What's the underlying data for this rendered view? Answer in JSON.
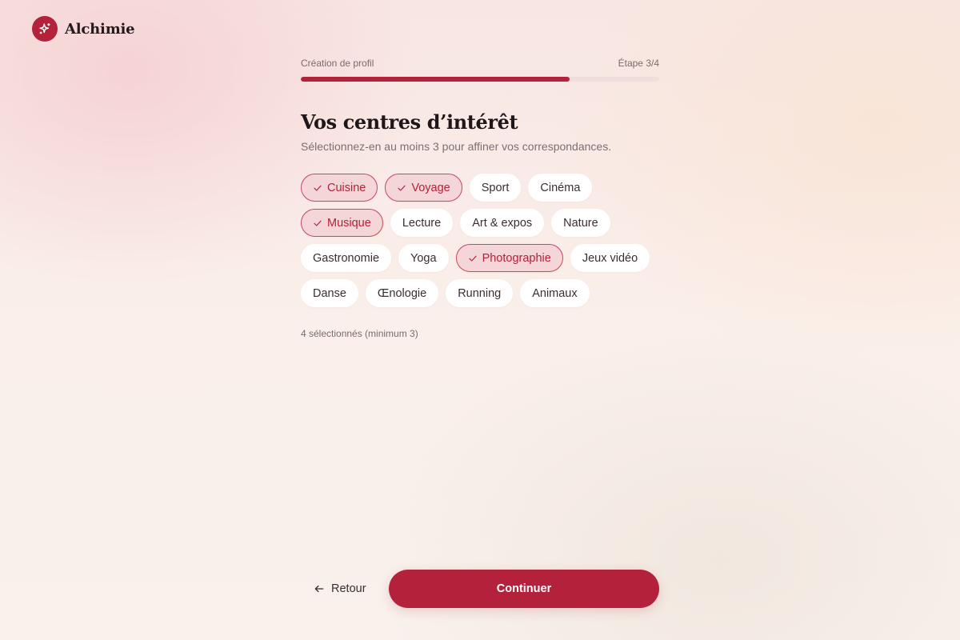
{
  "brand": {
    "name": "Alchimie",
    "logo_icon": "sparkle-icon"
  },
  "progress": {
    "label": "Création de profil",
    "step": "Étape 3/4",
    "fraction": 0.75
  },
  "heading": {
    "title": "Vos centres d’intérêt",
    "subtitle": "Sélectionnez-en au moins 3 pour affiner vos correspondances."
  },
  "interests": [
    {
      "label": "Cuisine",
      "selected": true
    },
    {
      "label": "Voyage",
      "selected": true
    },
    {
      "label": "Sport",
      "selected": false
    },
    {
      "label": "Cinéma",
      "selected": false
    },
    {
      "label": "Musique",
      "selected": true
    },
    {
      "label": "Lecture",
      "selected": false
    },
    {
      "label": "Art & expos",
      "selected": false
    },
    {
      "label": "Nature",
      "selected": false
    },
    {
      "label": "Gastronomie",
      "selected": false
    },
    {
      "label": "Yoga",
      "selected": false
    },
    {
      "label": "Photographie",
      "selected": true
    },
    {
      "label": "Jeux vidéo",
      "selected": false
    },
    {
      "label": "Danse",
      "selected": false
    },
    {
      "label": "Œnologie",
      "selected": false
    },
    {
      "label": "Running",
      "selected": false
    },
    {
      "label": "Animaux",
      "selected": false
    }
  ],
  "selection_count": "4 sélectionnés (minimum 3)",
  "footer": {
    "back_label": "Retour",
    "back_icon": "arrow-left-icon",
    "continue_label": "Continuer"
  },
  "colors": {
    "accent": "#b3213a",
    "selected_bg": "#f5d6d8",
    "selected_border": "#c44a5c"
  }
}
